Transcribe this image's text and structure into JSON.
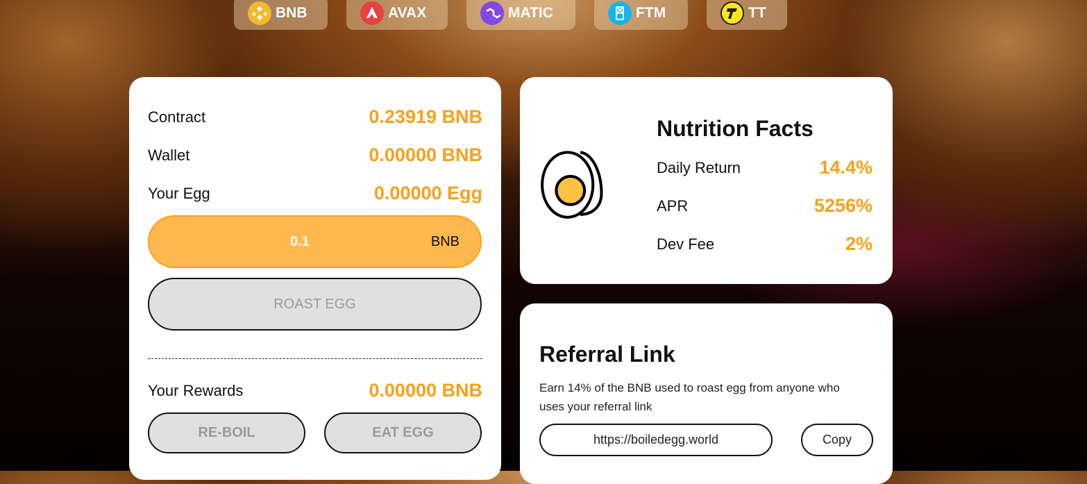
{
  "networks": [
    {
      "label": "BNB",
      "color": "#f3ba2f"
    },
    {
      "label": "AVAX",
      "color": "#e84142"
    },
    {
      "label": "MATIC",
      "color": "#8247e5"
    },
    {
      "label": "FTM",
      "color": "#13b5ec"
    },
    {
      "label": "TT",
      "color": "#ffe61a"
    }
  ],
  "main": {
    "contract_label": "Contract",
    "contract_value": "0.23919 BNB",
    "wallet_label": "Wallet",
    "wallet_value": "0.00000 BNB",
    "egg_label": "Your Egg",
    "egg_value": "0.00000 Egg",
    "amount_value": "0.1",
    "amount_unit": "BNB",
    "roast_label": "ROAST EGG",
    "rewards_label": "Your Rewards",
    "rewards_value": "0.00000 BNB",
    "reboil_label": "RE-BOIL",
    "eat_label": "EAT EGG"
  },
  "nutrition": {
    "title": "Nutrition Facts",
    "items": [
      {
        "label": "Daily Return",
        "value": "14.4%"
      },
      {
        "label": "APR",
        "value": "5256%"
      },
      {
        "label": "Dev Fee",
        "value": "2%"
      }
    ]
  },
  "referral": {
    "title": "Referral Link",
    "description": "Earn 14% of the BNB used to roast egg from anyone who uses your referral link",
    "link": "https://boiledegg.world",
    "copy_label": "Copy"
  },
  "colors": {
    "accent": "#f7a11a",
    "input_bg": "#ffb84d"
  }
}
